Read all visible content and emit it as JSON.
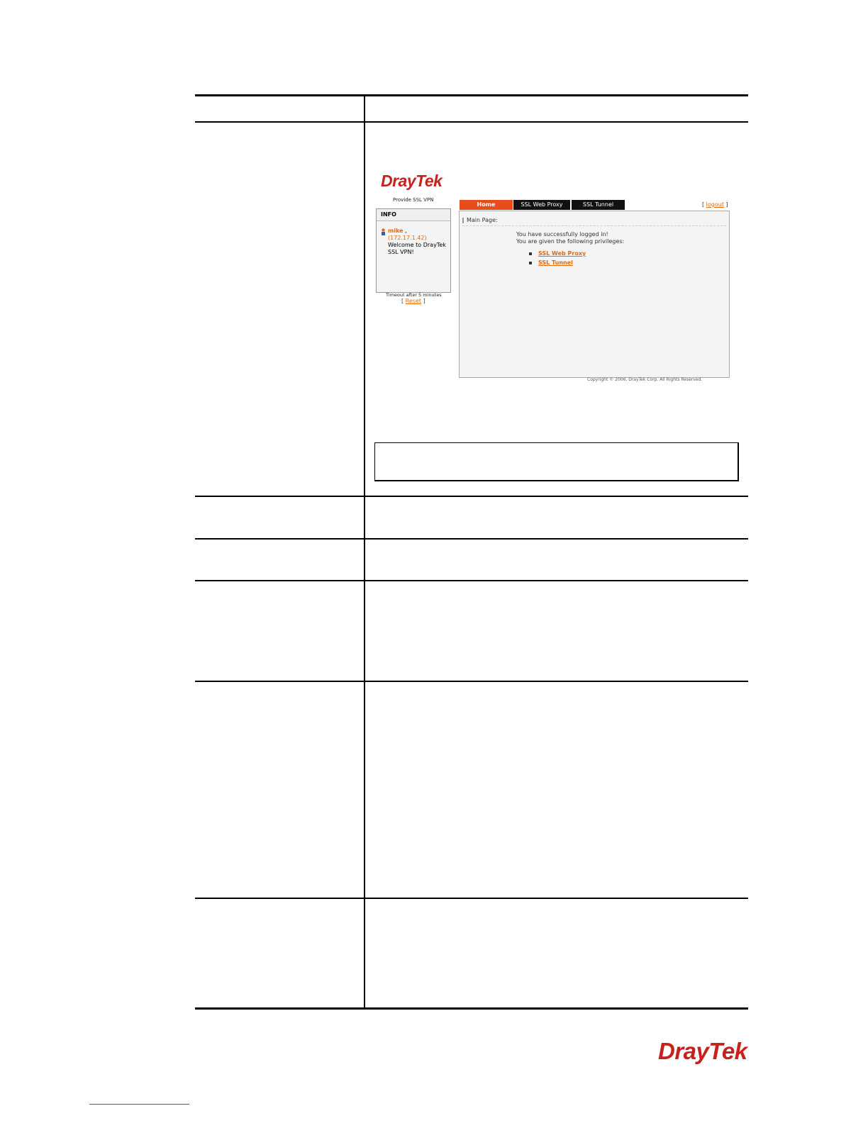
{
  "screenshot": {
    "logo": "DrayTek",
    "tagline": "Provide SSL VPN",
    "info": {
      "header": "INFO",
      "username": "mike",
      "comma": ",",
      "ip": "(172.17.1.42)",
      "welcome_line1": "Welcome to DrayTek",
      "welcome_line2": "SSL VPN!"
    },
    "timeout": "Timeout after 5 minutes",
    "reset_open": "[",
    "reset_label": "Reset",
    "reset_close": "]",
    "tabs": [
      "Home",
      "SSL Web Proxy",
      "SSL Tunnel"
    ],
    "logout_open": "[",
    "logout_label": "logout",
    "logout_close": "]",
    "main_title": "Main Page:",
    "message_line1": "You have successfully logged in!",
    "message_line2": "You are given the following privileges:",
    "privileges": [
      "SSL Web Proxy",
      "SSL Tunnel"
    ],
    "copyright": "Copyright © 2006, DrayTek Corp. All Rights Reserved."
  },
  "footer": {
    "logo": "DrayTek"
  },
  "colors": {
    "brand_red": "#c8201c",
    "tab_active": "#e84c1a",
    "link_orange": "#e06a10"
  }
}
